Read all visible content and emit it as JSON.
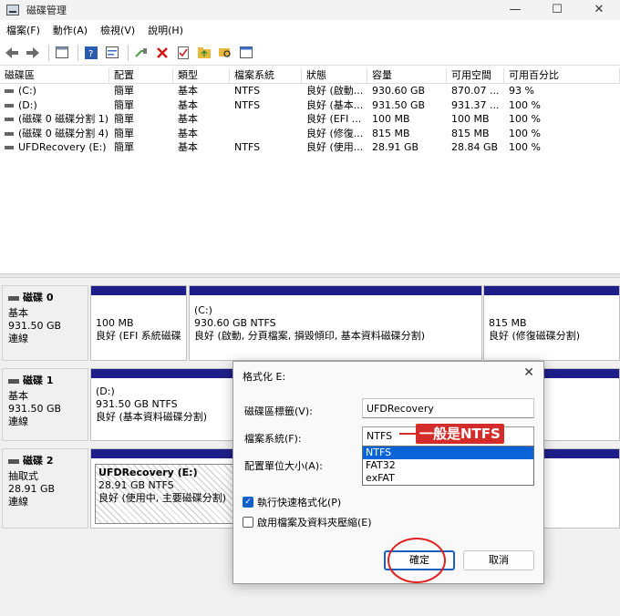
{
  "window": {
    "title": "磁碟管理",
    "controls": [
      "—",
      "☐",
      "✕"
    ]
  },
  "menu": [
    "檔案(F)",
    "動作(A)",
    "檢視(V)",
    "說明(H)"
  ],
  "toolbar": {
    "icons": [
      "back-arrow-icon",
      "forward-arrow-icon",
      "view-icon",
      "help-icon",
      "properties-icon",
      "connect-icon",
      "delete-icon",
      "checklist-icon",
      "folder-up-icon",
      "search-folder-icon",
      "window-icon"
    ]
  },
  "volume_table": {
    "headers": [
      "磁碟區",
      "配置",
      "類型",
      "檔案系統",
      "狀態",
      "容量",
      "可用空間",
      "可用百分比"
    ],
    "rows": [
      [
        "(C:)",
        "簡單",
        "基本",
        "NTFS",
        "良好 (啟動...",
        "930.60 GB",
        "870.07 ...",
        "93 %"
      ],
      [
        "(D:)",
        "簡單",
        "基本",
        "NTFS",
        "良好 (基本...",
        "931.50 GB",
        "931.37 ...",
        "100 %"
      ],
      [
        "(磁碟 0 磁碟分割 1)",
        "簡單",
        "基本",
        "",
        "良好 (EFI ...",
        "100 MB",
        "100 MB",
        "100 %"
      ],
      [
        "(磁碟 0 磁碟分割 4)",
        "簡單",
        "基本",
        "",
        "良好 (修復...",
        "815 MB",
        "815 MB",
        "100 %"
      ],
      [
        "UFDRecovery (E:)",
        "簡單",
        "基本",
        "NTFS",
        "良好 (使用...",
        "28.91 GB",
        "28.84 GB",
        "100 %"
      ]
    ]
  },
  "disks": [
    {
      "name": "磁碟 0",
      "type": "基本",
      "size": "931.50 GB",
      "status": "連線",
      "partitions": [
        {
          "title": "",
          "line1": "100 MB",
          "line2": "良好 (EFI 系統磁碟分"
        },
        {
          "title": "(C:)",
          "line1": "930.60 GB NTFS",
          "line2": "良好 (啟動, 分頁檔案, 損毀傾印, 基本資料磁碟分割)"
        },
        {
          "title": "",
          "line1": "815 MB",
          "line2": "良好 (修復磁碟分割)"
        }
      ]
    },
    {
      "name": "磁碟 1",
      "type": "基本",
      "size": "931.50 GB",
      "status": "連線",
      "partitions": [
        {
          "title": "(D:)",
          "line1": "931.50 GB NTFS",
          "line2": "良好 (基本資料磁碟分割)"
        }
      ]
    },
    {
      "name": "磁碟 2",
      "type": "抽取式",
      "size": "28.91 GB",
      "status": "連線",
      "partitions": [
        {
          "title": "UFDRecovery (E:)",
          "line1": "28.91 GB NTFS",
          "line2": "良好 (使用中, 主要磁碟分割)"
        }
      ]
    }
  ],
  "dialog": {
    "title": "格式化 E:",
    "label_volume": "磁碟區標籤(V):",
    "volume_value": "UFDRecovery",
    "label_fs": "檔案系統(F):",
    "fs_selected": "NTFS",
    "fs_options": [
      "NTFS",
      "FAT32",
      "exFAT"
    ],
    "label_alloc": "配置單位大小(A):",
    "quick_format": "執行快速格式化(P)",
    "quick_format_checked": true,
    "compression": "啟用檔案及資料夾壓縮(E)",
    "compression_checked": false,
    "ok": "確定",
    "cancel": "取消"
  },
  "annotation": {
    "callout": "一般是NTFS",
    "color": "#d42b2b"
  }
}
